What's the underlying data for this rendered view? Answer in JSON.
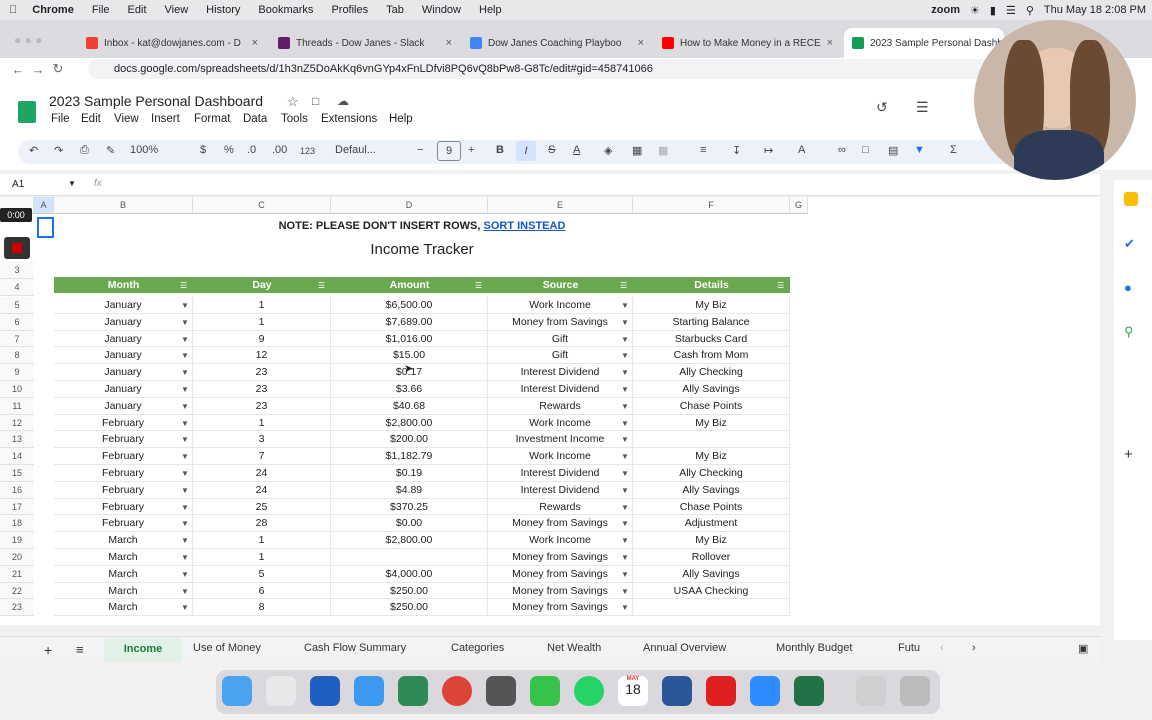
{
  "menubar": {
    "app": "Chrome",
    "items": [
      "File",
      "Edit",
      "View",
      "History",
      "Bookmarks",
      "Profiles",
      "Tab",
      "Window",
      "Help"
    ],
    "zoom_label": "zoom",
    "datetime": "Thu May 18  2:08 PM"
  },
  "tabs": [
    {
      "label": "Inbox - kat@dowjanes.com - D",
      "color": "#ea4335"
    },
    {
      "label": "Threads - Dow Janes - Slack",
      "color": "#611f69"
    },
    {
      "label": "Dow Janes Coaching Playboo",
      "color": "#4285f4"
    },
    {
      "label": "How to Make Money in a RECE",
      "color": "#ff0000"
    },
    {
      "label": "2023 Sample Personal Dashb",
      "color": "#0f9d58"
    }
  ],
  "address": {
    "url": "docs.google.com/spreadsheets/d/1h3nZ5DoAkKq6vnGYp4xFnLDfvi8PQ6vQ8bPw8-G8Tc/edit#gid=458741066"
  },
  "doc": {
    "title": "2023 Sample Personal Dashboard",
    "menus": [
      "File",
      "Edit",
      "View",
      "Insert",
      "Format",
      "Data",
      "Tools",
      "Extensions",
      "Help"
    ]
  },
  "toolbar": {
    "zoom": "100%",
    "currency": "$",
    "percent": "%",
    "dec_minus": ".0",
    "dec_plus": ".00",
    "num": "123",
    "font": "Defaul...",
    "size": "9",
    "bold": "B",
    "italic": "I",
    "strike": "S",
    "textcolor": "A",
    "sum": "Σ"
  },
  "formula": {
    "cell_ref": "A1",
    "fx": "fx"
  },
  "columns": [
    "A",
    "B",
    "C",
    "D",
    "E",
    "F",
    "G"
  ],
  "timer": "0:00",
  "note": {
    "prefix": "NOTE: PLEASE DON'T INSERT ROWS, ",
    "link": "SORT INSTEAD"
  },
  "sheet_title": "Income Tracker",
  "headers": [
    "Month",
    "Day",
    "Amount",
    "Source",
    "Details"
  ],
  "row_numbers": [
    "1",
    "2",
    "3",
    "4",
    "5",
    "6",
    "7",
    "8",
    "9",
    "10",
    "11",
    "12",
    "13",
    "14",
    "15",
    "16",
    "17",
    "18",
    "19",
    "20",
    "21",
    "22",
    "23"
  ],
  "rows": [
    [
      "January",
      "1",
      "$6,500.00",
      "Work Income",
      "My Biz"
    ],
    [
      "January",
      "1",
      "$7,689.00",
      "Money from Savings",
      "Starting Balance"
    ],
    [
      "January",
      "9",
      "$1,016.00",
      "Gift",
      "Starbucks Card"
    ],
    [
      "January",
      "12",
      "$15.00",
      "Gift",
      "Cash from Mom"
    ],
    [
      "January",
      "23",
      "$0.17",
      "Interest Dividend",
      "Ally Checking"
    ],
    [
      "January",
      "23",
      "$3.66",
      "Interest Dividend",
      "Ally Savings"
    ],
    [
      "January",
      "23",
      "$40.68",
      "Rewards",
      "Chase Points"
    ],
    [
      "February",
      "1",
      "$2,800.00",
      "Work Income",
      "My Biz"
    ],
    [
      "February",
      "3",
      "$200.00",
      "Investment Income",
      ""
    ],
    [
      "February",
      "7",
      "$1,182.79",
      "Work Income",
      "My Biz"
    ],
    [
      "February",
      "24",
      "$0.19",
      "Interest Dividend",
      "Ally Checking"
    ],
    [
      "February",
      "24",
      "$4.89",
      "Interest Dividend",
      "Ally Savings"
    ],
    [
      "February",
      "25",
      "$370.25",
      "Rewards",
      "Chase Points"
    ],
    [
      "February",
      "28",
      "$0.00",
      "Money from Savings",
      "Adjustment"
    ],
    [
      "March",
      "1",
      "$2,800.00",
      "Work Income",
      "My Biz"
    ],
    [
      "March",
      "1",
      "",
      "Money from Savings",
      "Rollover"
    ],
    [
      "March",
      "5",
      "$4,000.00",
      "Money from Savings",
      "Ally Savings"
    ],
    [
      "March",
      "6",
      "$250.00",
      "Money from Savings",
      "USAA Checking"
    ],
    [
      "March",
      "8",
      "$250.00",
      "Money from Savings",
      ""
    ]
  ],
  "sheet_tabs": [
    "Income",
    "Use of Money",
    "Cash Flow Summary",
    "Categories",
    "Net Wealth",
    "Annual Overview",
    "Monthly Budget",
    "Futu"
  ],
  "dock_date": {
    "month": "MAY",
    "day": "18"
  },
  "colors": {
    "header_green": "#6aa84f",
    "link_blue": "#1155cc",
    "tab_active": "#188038"
  }
}
